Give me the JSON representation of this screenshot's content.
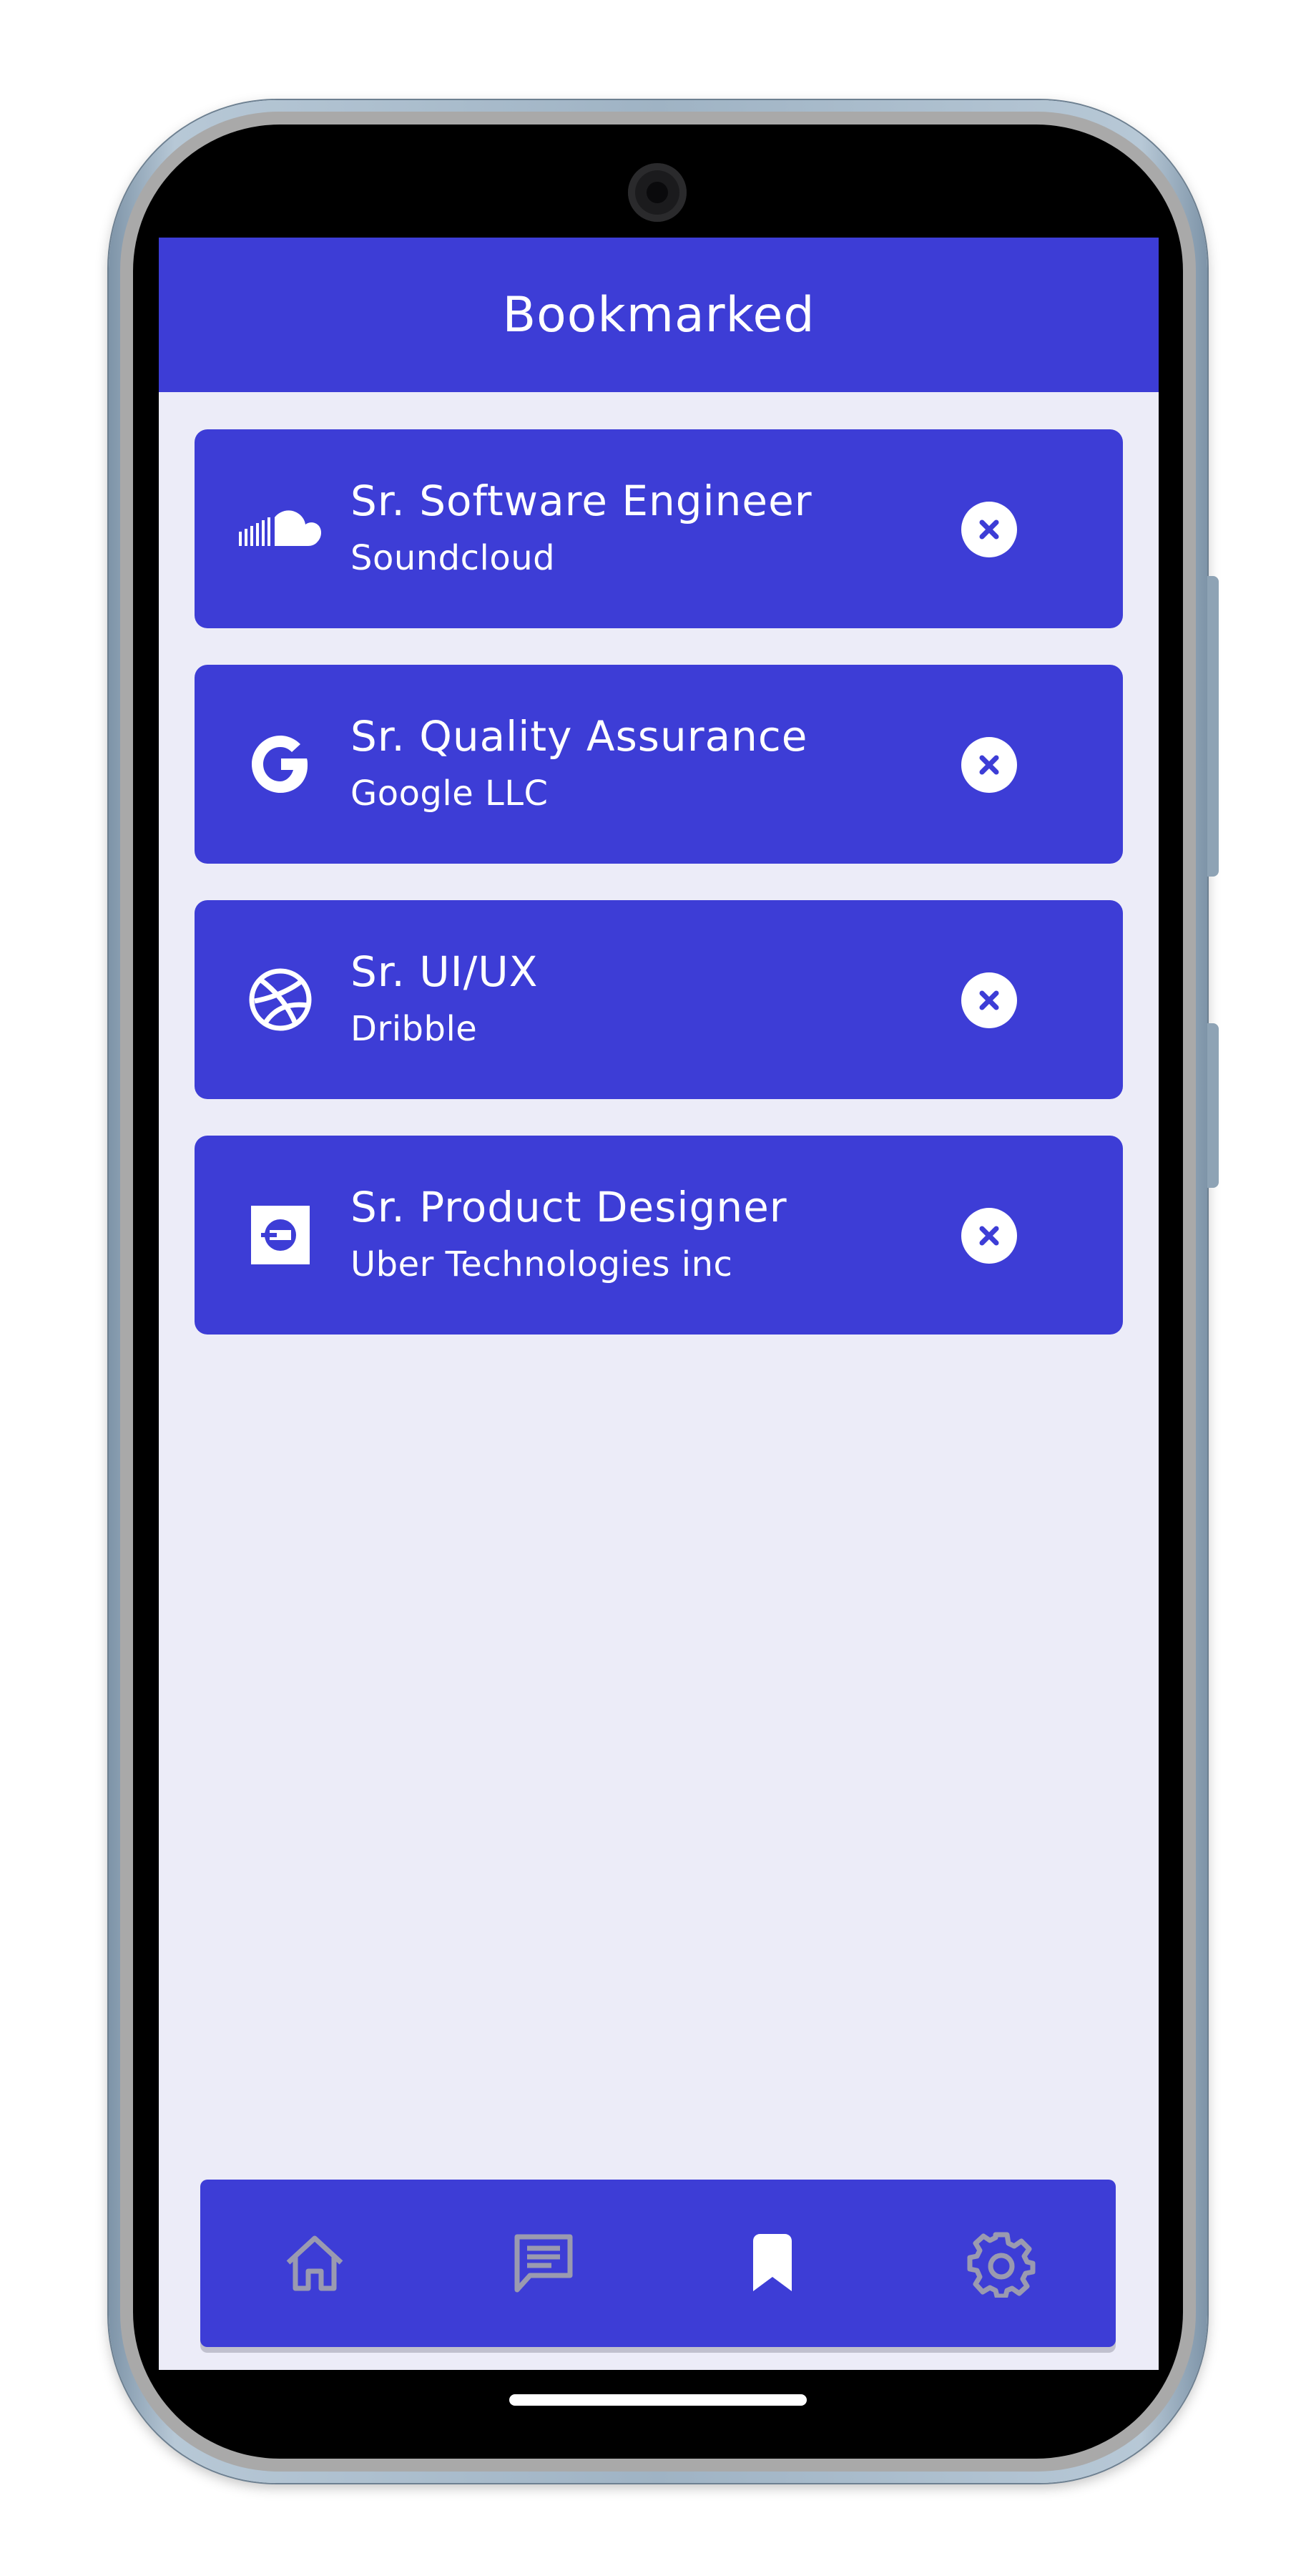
{
  "appbar": {
    "title": "Bookmarked"
  },
  "bookmarks": [
    {
      "title": "Sr. Software Engineer",
      "company": "Soundcloud",
      "logo_icon": "soundcloud-icon"
    },
    {
      "title": "Sr. Quality Assurance",
      "company": "Google LLC",
      "logo_icon": "google-icon"
    },
    {
      "title": "Sr. UI/UX",
      "company": "Dribble",
      "logo_icon": "dribbble-icon"
    },
    {
      "title": "Sr. Product Designer",
      "company": "Uber Technologies inc",
      "logo_icon": "uber-icon"
    }
  ],
  "bottom_nav": {
    "items": [
      {
        "icon": "home-icon",
        "active": false
      },
      {
        "icon": "chat-icon",
        "active": false
      },
      {
        "icon": "bookmark-icon",
        "active": true
      },
      {
        "icon": "settings-icon",
        "active": false
      }
    ]
  },
  "colors": {
    "primary": "#3d3dd6",
    "background": "#ececf8",
    "on_primary": "#ffffff",
    "inactive_icon": "#9a9ab0"
  }
}
